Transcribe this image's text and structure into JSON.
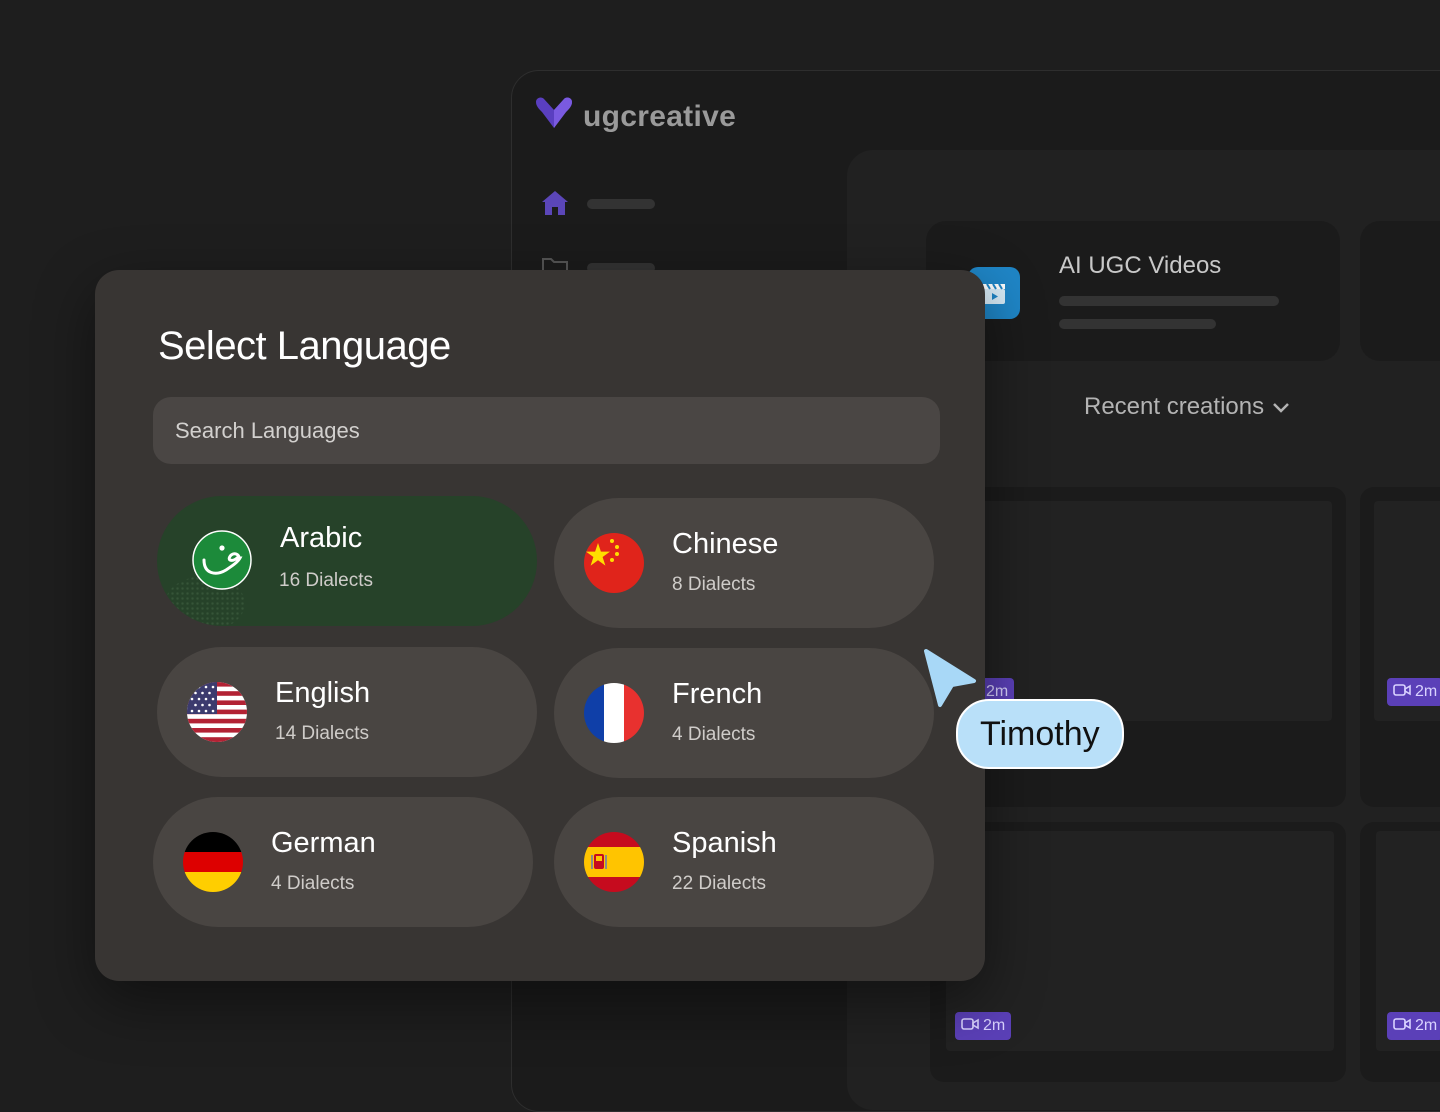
{
  "app": {
    "brand_name": "ugcreative",
    "brand_logo_icon": "heart-v-logo-icon",
    "nav": [
      {
        "icon": "home-icon",
        "color": "#5b46b8"
      },
      {
        "icon": "folder-icon"
      }
    ]
  },
  "feature_card": {
    "title": "AI UGC Videos",
    "icon": "clapperboard-icon",
    "icon_color": "#1f86c7"
  },
  "recent": {
    "label": "Recent creations",
    "icon": "chevron-down-icon"
  },
  "thumbnails": [
    {
      "duration": "2m"
    },
    {
      "duration": "2m"
    },
    {
      "duration": "2m"
    },
    {
      "duration": "2m"
    }
  ],
  "modal": {
    "title": "Select Language",
    "search_placeholder": "Search Languages",
    "languages": [
      {
        "name": "Arabic",
        "dialects": "16 Dialects",
        "flag": "arabic-flag-icon",
        "selected": true
      },
      {
        "name": "Chinese",
        "dialects": "8 Dialects",
        "flag": "china-flag-icon",
        "selected": false
      },
      {
        "name": "English",
        "dialects": "14 Dialects",
        "flag": "usa-flag-icon",
        "selected": false
      },
      {
        "name": "French",
        "dialects": "4 Dialects",
        "flag": "france-flag-icon",
        "selected": false
      },
      {
        "name": "German",
        "dialects": "4 Dialects",
        "flag": "germany-flag-icon",
        "selected": false
      },
      {
        "name": "Spanish",
        "dialects": "22 Dialects",
        "flag": "spain-flag-icon",
        "selected": false
      }
    ]
  },
  "collaborator": {
    "name": "Timothy",
    "cursor_icon": "pointer-cursor-icon",
    "color": "#b9e0f9"
  },
  "colors": {
    "modal_bg": "#383533",
    "pill_bg": "#494542",
    "selected_pill_bg": "#264229",
    "badge_bg": "#5b40b8"
  }
}
